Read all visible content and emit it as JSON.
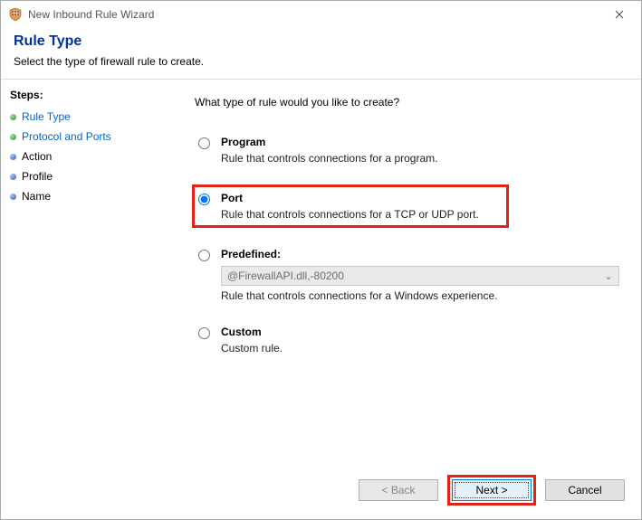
{
  "window": {
    "title": "New Inbound Rule Wizard"
  },
  "header": {
    "title": "Rule Type",
    "subtitle": "Select the type of firewall rule to create."
  },
  "sidebar": {
    "title": "Steps:",
    "items": [
      {
        "label": "Rule Type",
        "state": "active"
      },
      {
        "label": "Protocol and Ports",
        "state": "link"
      },
      {
        "label": "Action",
        "state": "pending"
      },
      {
        "label": "Profile",
        "state": "pending"
      },
      {
        "label": "Name",
        "state": "pending"
      }
    ]
  },
  "main": {
    "question": "What type of rule would you like to create?",
    "options": [
      {
        "key": "program",
        "title": "Program",
        "desc": "Rule that controls connections for a program.",
        "selected": false
      },
      {
        "key": "port",
        "title": "Port",
        "desc": "Rule that controls connections for a TCP or UDP port.",
        "selected": true,
        "highlight": true
      },
      {
        "key": "predefined",
        "title": "Predefined:",
        "desc": "Rule that controls connections for a Windows experience.",
        "selected": false,
        "select_value": "@FirewallAPI.dll,-80200"
      },
      {
        "key": "custom",
        "title": "Custom",
        "desc": "Custom rule.",
        "selected": false
      }
    ]
  },
  "footer": {
    "back": "< Back",
    "next": "Next >",
    "cancel": "Cancel"
  }
}
